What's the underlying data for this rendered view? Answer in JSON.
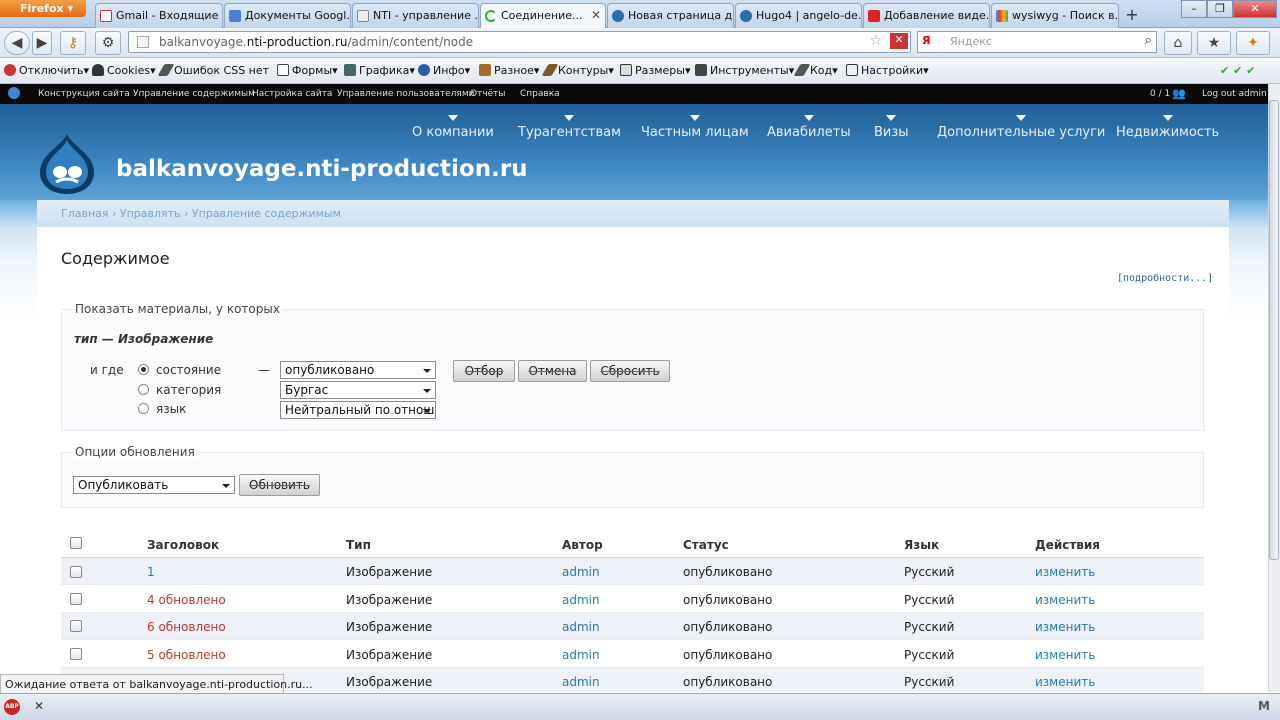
{
  "browser": {
    "app_name": "Firefox",
    "tabs": [
      {
        "label": "Gmail - Входящие ...",
        "icon": "gmail-icon"
      },
      {
        "label": "Документы Googl...",
        "icon": "docs-icon"
      },
      {
        "label": "NTI - управление ...",
        "icon": "page-icon"
      },
      {
        "label": "Соединение...",
        "icon": "loading-icon"
      },
      {
        "label": "Новая страница д...",
        "icon": "drupal-icon"
      },
      {
        "label": "Hugo4 | angelo-de...",
        "icon": "drupal-icon"
      },
      {
        "label": "Добавление виде...",
        "icon": "youtube-icon"
      },
      {
        "label": "wysiwyg - Поиск в...",
        "icon": "google-icon"
      }
    ],
    "url_prefix": "balkanvoyage.",
    "url_domain": "nti-production.ru",
    "url_path": "/admin/content/node",
    "search_placeholder": "Яндекс",
    "search_engine_label": "Я"
  },
  "devbar": {
    "items": [
      "Отключить",
      "Cookies",
      "Ошибок CSS нет",
      "Формы",
      "Графика",
      "Инфо",
      "Разное",
      "Контуры",
      "Размеры",
      "Инструменты",
      "Код",
      "Настройки"
    ]
  },
  "admin_toolbar": {
    "items": [
      "Конструкция сайта",
      "Управление содержимым",
      "Настройка сайта",
      "Управление пользователями",
      "Отчёты",
      "Справка"
    ],
    "counter": "0 / 1",
    "logout": "Log out admin"
  },
  "site": {
    "name": "balkanvoyage.nti-production.ru",
    "menu": [
      "О компании",
      "Турагентствам",
      "Частным лицам",
      "Авиабилеты",
      "Визы",
      "Дополнительные услуги",
      "Недвижимость"
    ],
    "breadcrumb": "Главная › Управлять › Управление содержимым"
  },
  "content": {
    "title": "Содержимое",
    "more_link": "[подробности...]",
    "filter": {
      "legend": "Показать материалы, у которых",
      "type_label": "тип — Изображение",
      "where_label": "и где",
      "dash": "—",
      "options": [
        "состояние",
        "категория",
        "язык"
      ],
      "selected_option": "состояние",
      "selects": [
        "опубликовано",
        "Бургас",
        "Нейтральный по отношению"
      ],
      "buttons": [
        "Отбор",
        "Отмена",
        "Сбросить"
      ]
    },
    "update": {
      "legend": "Опции обновления",
      "select": "Опубликовать",
      "button": "Обновить"
    },
    "table": {
      "headers": [
        "Заголовок",
        "Тип",
        "Автор",
        "Статус",
        "Язык",
        "Действия"
      ],
      "rows": [
        {
          "title": "1",
          "type": "Изображение",
          "author": "admin",
          "status": "опубликовано",
          "lang": "Русский",
          "action": "изменить"
        },
        {
          "title": "4 обновлено",
          "type": "Изображение",
          "author": "admin",
          "status": "опубликовано",
          "lang": "Русский",
          "action": "изменить"
        },
        {
          "title": "6 обновлено",
          "type": "Изображение",
          "author": "admin",
          "status": "опубликовано",
          "lang": "Русский",
          "action": "изменить"
        },
        {
          "title": "5 обновлено",
          "type": "Изображение",
          "author": "admin",
          "status": "опубликовано",
          "lang": "Русский",
          "action": "изменить"
        },
        {
          "title": "",
          "type": "Изображение",
          "author": "admin",
          "status": "опубликовано",
          "lang": "Русский",
          "action": "изменить"
        }
      ]
    }
  },
  "status_text": "Ожидание ответа от balkanvoyage.nti-production.ru...",
  "colors": {
    "header": "#2f78b6",
    "link": "#2a7ab0",
    "updated": "#c0392b"
  }
}
